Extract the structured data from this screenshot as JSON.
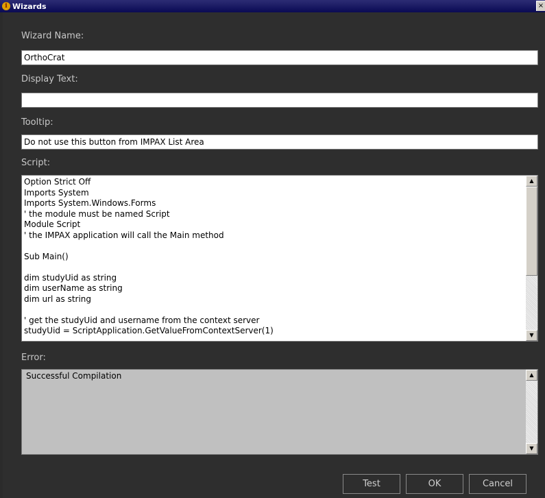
{
  "window": {
    "title": "Wizards",
    "close_glyph": "×"
  },
  "fields": {
    "wizard_name_label": "Wizard Name:",
    "wizard_name_value": "OrthoCrat",
    "display_text_label": "Display Text:",
    "display_text_value": "",
    "tooltip_label": "Tooltip:",
    "tooltip_value": "Do not use this button from IMPAX List Area"
  },
  "script": {
    "label": "Script:",
    "lines": [
      "Option Strict Off",
      "Imports System",
      "Imports System.Windows.Forms",
      "' the module must be named Script",
      "Module Script",
      "' the IMPAX application will call the Main method",
      "",
      "Sub Main()",
      "",
      "dim studyUid as string",
      "dim userName as string",
      "dim url as string",
      "",
      "' get the studyUid and username from the context server",
      "studyUid = ScriptApplication.GetValueFromContextServer(1)"
    ]
  },
  "error": {
    "label": "Error:",
    "text": "Successful Compilation"
  },
  "buttons": {
    "test": "Test",
    "ok": "OK",
    "cancel": "Cancel"
  },
  "icons": {
    "app": "info-icon",
    "scroll_up": "arrow-up-icon",
    "scroll_down": "arrow-down-icon"
  },
  "colors": {
    "background": "#2e2e2e",
    "titlebar": "#0a0a54",
    "error_background": "#c0c0c0"
  }
}
